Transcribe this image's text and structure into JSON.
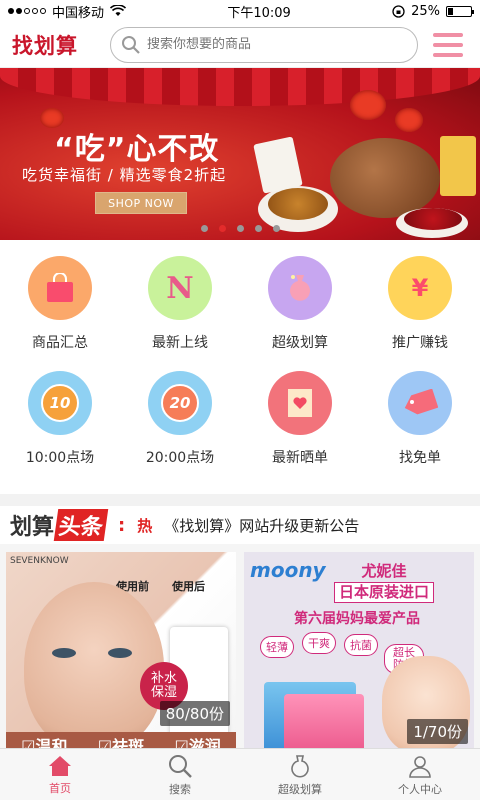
{
  "status": {
    "carrier": "中国移动",
    "time": "下午10:09",
    "battery": "25%",
    "battery_level": 0.25
  },
  "header": {
    "logo": "找划算",
    "search_placeholder": "搜索你想要的商品"
  },
  "banner": {
    "title": "“吃”心不改",
    "subtitle": "吃货幸福街 / 精选零食2折起",
    "button": "SHOP NOW",
    "pages": 5,
    "active_page": 2
  },
  "grid": [
    {
      "label": "商品汇总",
      "icon": "shopping-bag-icon",
      "color": "#fba86a"
    },
    {
      "label": "最新上线",
      "icon": "new-n-icon",
      "color": "#c9f29b",
      "glyph": "N"
    },
    {
      "label": "超级划算",
      "icon": "money-bag-icon",
      "color": "#c7a6f0"
    },
    {
      "label": "推广赚钱",
      "icon": "yen-icon",
      "color": "#ffd45a",
      "glyph": "¥"
    },
    {
      "label": "10:00点场",
      "icon": "clock-10-icon",
      "color": "#8fd1f3",
      "glyph": "10"
    },
    {
      "label": "20:00点场",
      "icon": "clock-20-icon",
      "color": "#8fd1f3",
      "glyph": "20"
    },
    {
      "label": "最新晒单",
      "icon": "heart-note-icon",
      "color": "#f2737b"
    },
    {
      "label": "找免单",
      "icon": "free-tag-icon",
      "color": "#9ec7f5"
    }
  ],
  "headline": {
    "logo_a": "划算",
    "logo_b": "头条",
    "hot": "热",
    "text": "《找划算》网站升级更新公告"
  },
  "products": [
    {
      "tag": "80/80份",
      "brand": "SEVENKNOW",
      "before": "使用前",
      "after": "使用后",
      "badge": "补水\n保湿",
      "strip": [
        "☑温和",
        "☑祛斑",
        "☑滋润"
      ]
    },
    {
      "tag": "1/70份",
      "brand": "moony",
      "title1": "尤妮佳",
      "title2": "日本原装进口",
      "line": "第六届妈妈最爱产品",
      "pills": [
        "轻薄",
        "干爽",
        "抗菌",
        "超长防护"
      ]
    }
  ],
  "tabs": [
    {
      "label": "首页",
      "icon": "home-icon",
      "active": true
    },
    {
      "label": "搜索",
      "icon": "search-icon",
      "active": false
    },
    {
      "label": "超级划算",
      "icon": "money-bag-icon",
      "active": false
    },
    {
      "label": "个人中心",
      "icon": "user-icon",
      "active": false
    }
  ]
}
